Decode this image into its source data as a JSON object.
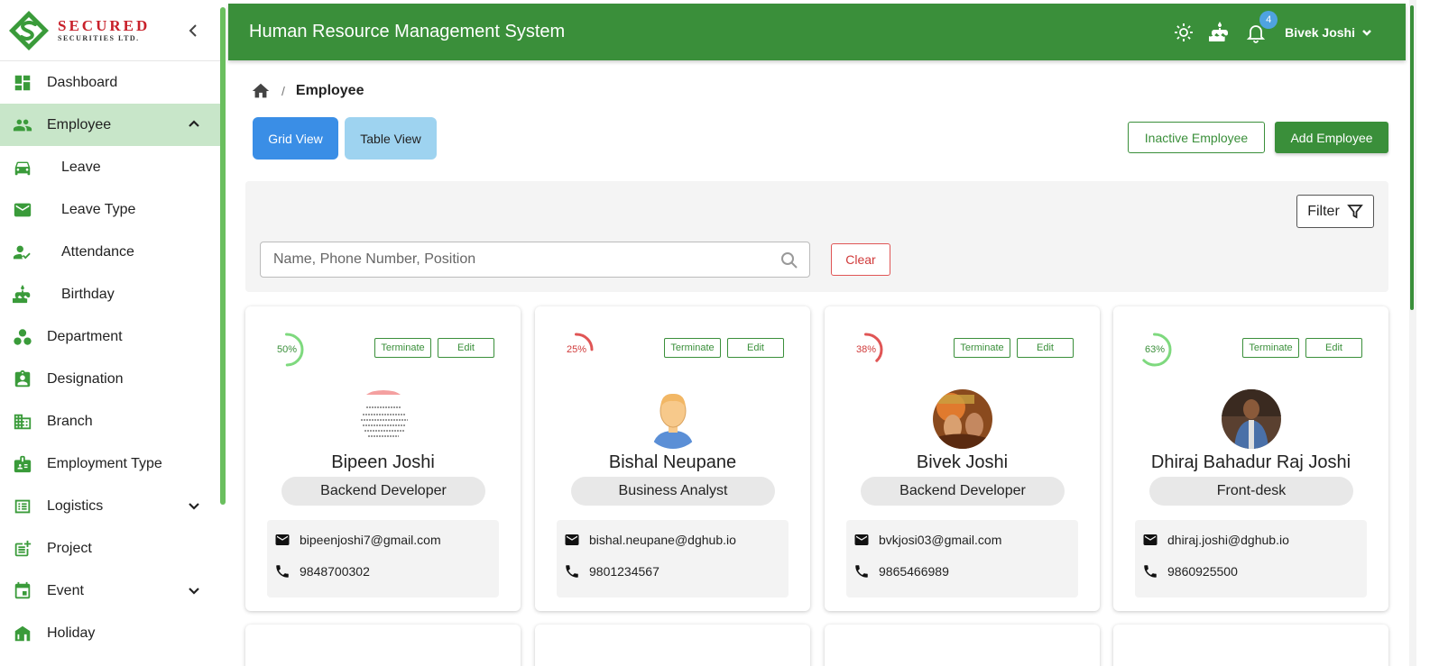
{
  "brand": {
    "title": "SECURED",
    "subtitle": "SECURITIES LTD."
  },
  "sidebar": {
    "items": [
      {
        "label": "Dashboard",
        "icon": "dashboard-icon"
      },
      {
        "label": "Employee",
        "icon": "people-icon",
        "active": true,
        "expanded": true
      },
      {
        "label": "Leave",
        "icon": "car-icon",
        "sub": true
      },
      {
        "label": "Leave Type",
        "icon": "mail-icon",
        "sub": true
      },
      {
        "label": "Attendance",
        "icon": "person-check-icon",
        "sub": true
      },
      {
        "label": "Birthday",
        "icon": "cake-icon",
        "sub": true
      },
      {
        "label": "Department",
        "icon": "workspaces-icon"
      },
      {
        "label": "Designation",
        "icon": "badge-icon"
      },
      {
        "label": "Branch",
        "icon": "building-icon"
      },
      {
        "label": "Employment Type",
        "icon": "id-card-icon"
      },
      {
        "label": "Logistics",
        "icon": "list-icon",
        "collapsible": true
      },
      {
        "label": "Project",
        "icon": "chart-add-icon"
      },
      {
        "label": "Event",
        "icon": "calendar-icon",
        "collapsible": true
      },
      {
        "label": "Holiday",
        "icon": "holiday-icon"
      }
    ]
  },
  "header": {
    "title": "Human Resource Management System",
    "notification_count": "4",
    "user_name": "Bivek Joshi"
  },
  "breadcrumb": {
    "current": "Employee",
    "separator": "/"
  },
  "toolbar": {
    "grid_view": "Grid View",
    "table_view": "Table View",
    "inactive": "Inactive Employee",
    "add": "Add Employee"
  },
  "filter": {
    "button": "Filter",
    "placeholder": "Name, Phone Number, Position",
    "clear": "Clear"
  },
  "colors": {
    "primary": "#3a8f3a",
    "accent_blue": "#3a8ee6",
    "danger": "#d03a3a",
    "progress_green": "#7ed97e",
    "progress_red": "#e05555"
  },
  "employees": [
    {
      "progress": "50%",
      "progress_value": 0.5,
      "status": "green",
      "name": "Bipeen Joshi",
      "position": "Backend Developer",
      "email": "bipeenjoshi7@gmail.com",
      "phone": "9848700302",
      "terminate": "Terminate",
      "edit": "Edit",
      "avatar": "document-avatar"
    },
    {
      "progress": "25%",
      "progress_value": 0.25,
      "status": "red",
      "name": "Bishal Neupane",
      "position": "Business Analyst",
      "email": "bishal.neupane@dghub.io",
      "phone": "9801234567",
      "terminate": "Terminate",
      "edit": "Edit",
      "avatar": "default-person-avatar"
    },
    {
      "progress": "38%",
      "progress_value": 0.38,
      "status": "red",
      "name": "Bivek Joshi",
      "position": "Backend Developer",
      "email": "bvkjosi03@gmail.com",
      "phone": "9865466989",
      "terminate": "Terminate",
      "edit": "Edit",
      "avatar": "photo-avatar"
    },
    {
      "progress": "63%",
      "progress_value": 0.63,
      "status": "green",
      "name": "Dhiraj Bahadur Raj Joshi",
      "position": "Front-desk",
      "email": "dhiraj.joshi@dghub.io",
      "phone": "9860925500",
      "terminate": "Terminate",
      "edit": "Edit",
      "avatar": "photo-avatar"
    }
  ]
}
